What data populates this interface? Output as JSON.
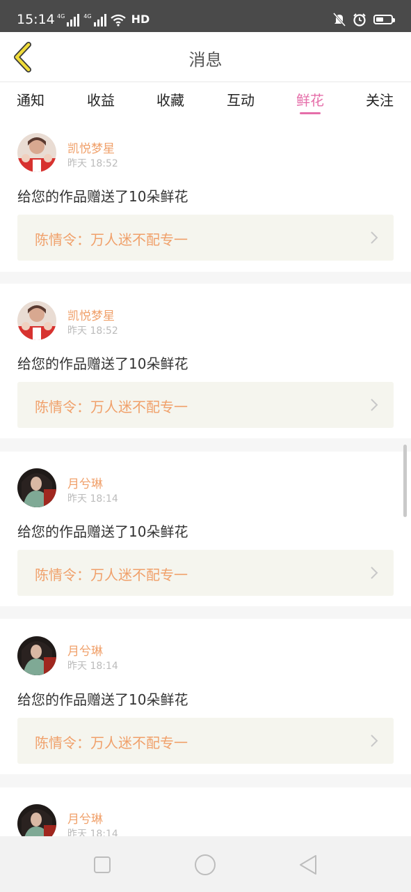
{
  "status_bar": {
    "time": "15:14",
    "network_labels": [
      "4G",
      "4G"
    ],
    "hd_label": "HD",
    "battery_level": 0.5
  },
  "header": {
    "title": "消息",
    "back_icon": "chevron-left-icon"
  },
  "tabs": [
    {
      "label": "通知",
      "active": false
    },
    {
      "label": "收益",
      "active": false
    },
    {
      "label": "收藏",
      "active": false
    },
    {
      "label": "互动",
      "active": false
    },
    {
      "label": "鲜花",
      "active": true
    },
    {
      "label": "关注",
      "active": false
    }
  ],
  "items": [
    {
      "username": "凯悦梦星",
      "time": "昨天 18:52",
      "message": "给您的作品赠送了10朵鲜花",
      "work_title": "陈情令：万人迷不配专一"
    },
    {
      "username": "凯悦梦星",
      "time": "昨天 18:52",
      "message": "给您的作品赠送了10朵鲜花",
      "work_title": "陈情令：万人迷不配专一"
    },
    {
      "username": "月兮琳",
      "time": "昨天 18:14",
      "message": "给您的作品赠送了10朵鲜花",
      "work_title": "陈情令：万人迷不配专一"
    },
    {
      "username": "月兮琳",
      "time": "昨天 18:14",
      "message": "给您的作品赠送了10朵鲜花",
      "work_title": "陈情令：万人迷不配专一"
    },
    {
      "username": "月兮琳",
      "time": "昨天 18:14"
    }
  ],
  "colors": {
    "accent_pink": "#e56ea9",
    "username_orange": "#f0a06a",
    "back_arrow_yellow": "#f0dc3a"
  },
  "nav_bar": {
    "icons": [
      "square-icon",
      "circle-icon",
      "triangle-back-icon"
    ]
  }
}
